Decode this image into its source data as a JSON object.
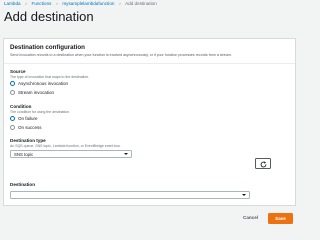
{
  "breadcrumb": {
    "items": [
      "Lambda",
      "Functions",
      "mysamplelambdafunction",
      "Add destination"
    ],
    "separator": ">"
  },
  "page": {
    "title": "Add destination"
  },
  "panel": {
    "title": "Destination configuration",
    "description": "Send invocation records to a destination when your function is invoked asynchronously, or if your function processes records from a stream."
  },
  "source": {
    "label": "Source",
    "hint": "The type of invocation that maps to the destination.",
    "options": [
      "Asynchronous invocation",
      "Stream invocation"
    ],
    "selected": "Asynchronous invocation"
  },
  "condition": {
    "label": "Condition",
    "hint": "The condition for using the destination.",
    "options": [
      "On failure",
      "On success"
    ],
    "selected": "On failure"
  },
  "destination_type": {
    "label": "Destination type",
    "hint": "An SQS queue, SNS topic, Lambda function, or EventBridge event bus.",
    "value": "SNS topic"
  },
  "destination": {
    "label": "Destination",
    "value": ""
  },
  "actions": {
    "cancel": "Cancel",
    "save": "Save"
  },
  "icons": {
    "refresh": "refresh-icon",
    "caret": "caret-down-icon"
  },
  "colors": {
    "link": "#0073bb",
    "primary": "#ec7211",
    "background": "#f2f3f3",
    "panel": "#ffffff"
  }
}
